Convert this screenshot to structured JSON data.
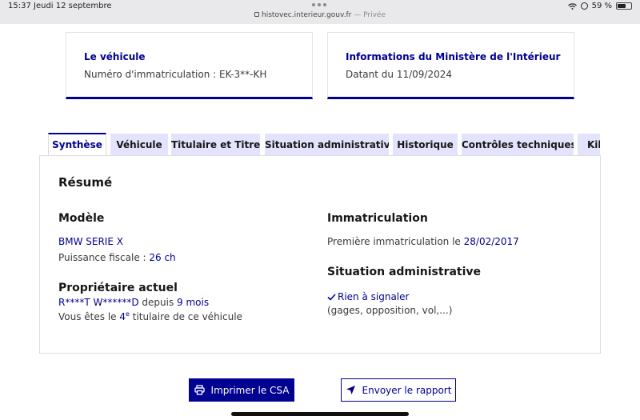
{
  "status": {
    "time": "15:37",
    "date": "Jeudi 12 septembre",
    "url": "histovec.interieur.gouv.fr",
    "private_label": "— Privée",
    "battery": "59 %"
  },
  "cards": {
    "vehicle": {
      "title": "Le véhicule",
      "text": "Numéro d'immatriculation : EK-3**-KH"
    },
    "ministry": {
      "title": "Informations du Ministère de l'Intérieur",
      "text": "Datant du 11/09/2024"
    }
  },
  "tabs": [
    {
      "label": "Synthèse",
      "active": true
    },
    {
      "label": "Véhicule"
    },
    {
      "label": "Titulaire et Titre"
    },
    {
      "label": "Situation administrative"
    },
    {
      "label": "Historique"
    },
    {
      "label": "Contrôles techniques"
    },
    {
      "label": "Kilométrage"
    }
  ],
  "summary": {
    "title": "Résumé",
    "model": {
      "heading": "Modèle",
      "name": "BMW SERIE X",
      "fiscal_label": "Puissance fiscale : ",
      "fiscal_value": "26 ch"
    },
    "owner": {
      "heading": "Propriétaire actuel",
      "name": "R****T W******D",
      "since_label": " depuis ",
      "since_value": "9 mois",
      "rank_prefix": "Vous êtes le ",
      "rank_value": "4",
      "rank_suffix": "e",
      "rank_rest": " titulaire de ce véhicule"
    },
    "registration": {
      "heading": "Immatriculation",
      "first_label": "Première immatriculation le ",
      "first_date": "28/02/2017"
    },
    "admin": {
      "heading": "Situation administrative",
      "status": "Rien à signaler",
      "details": "(gages, opposition, vol,...)"
    }
  },
  "buttons": {
    "print": "Imprimer le CSA",
    "send": "Envoyer le rapport"
  },
  "colors": {
    "accent": "#000091",
    "tab_inactive": "#e3e3fd"
  }
}
